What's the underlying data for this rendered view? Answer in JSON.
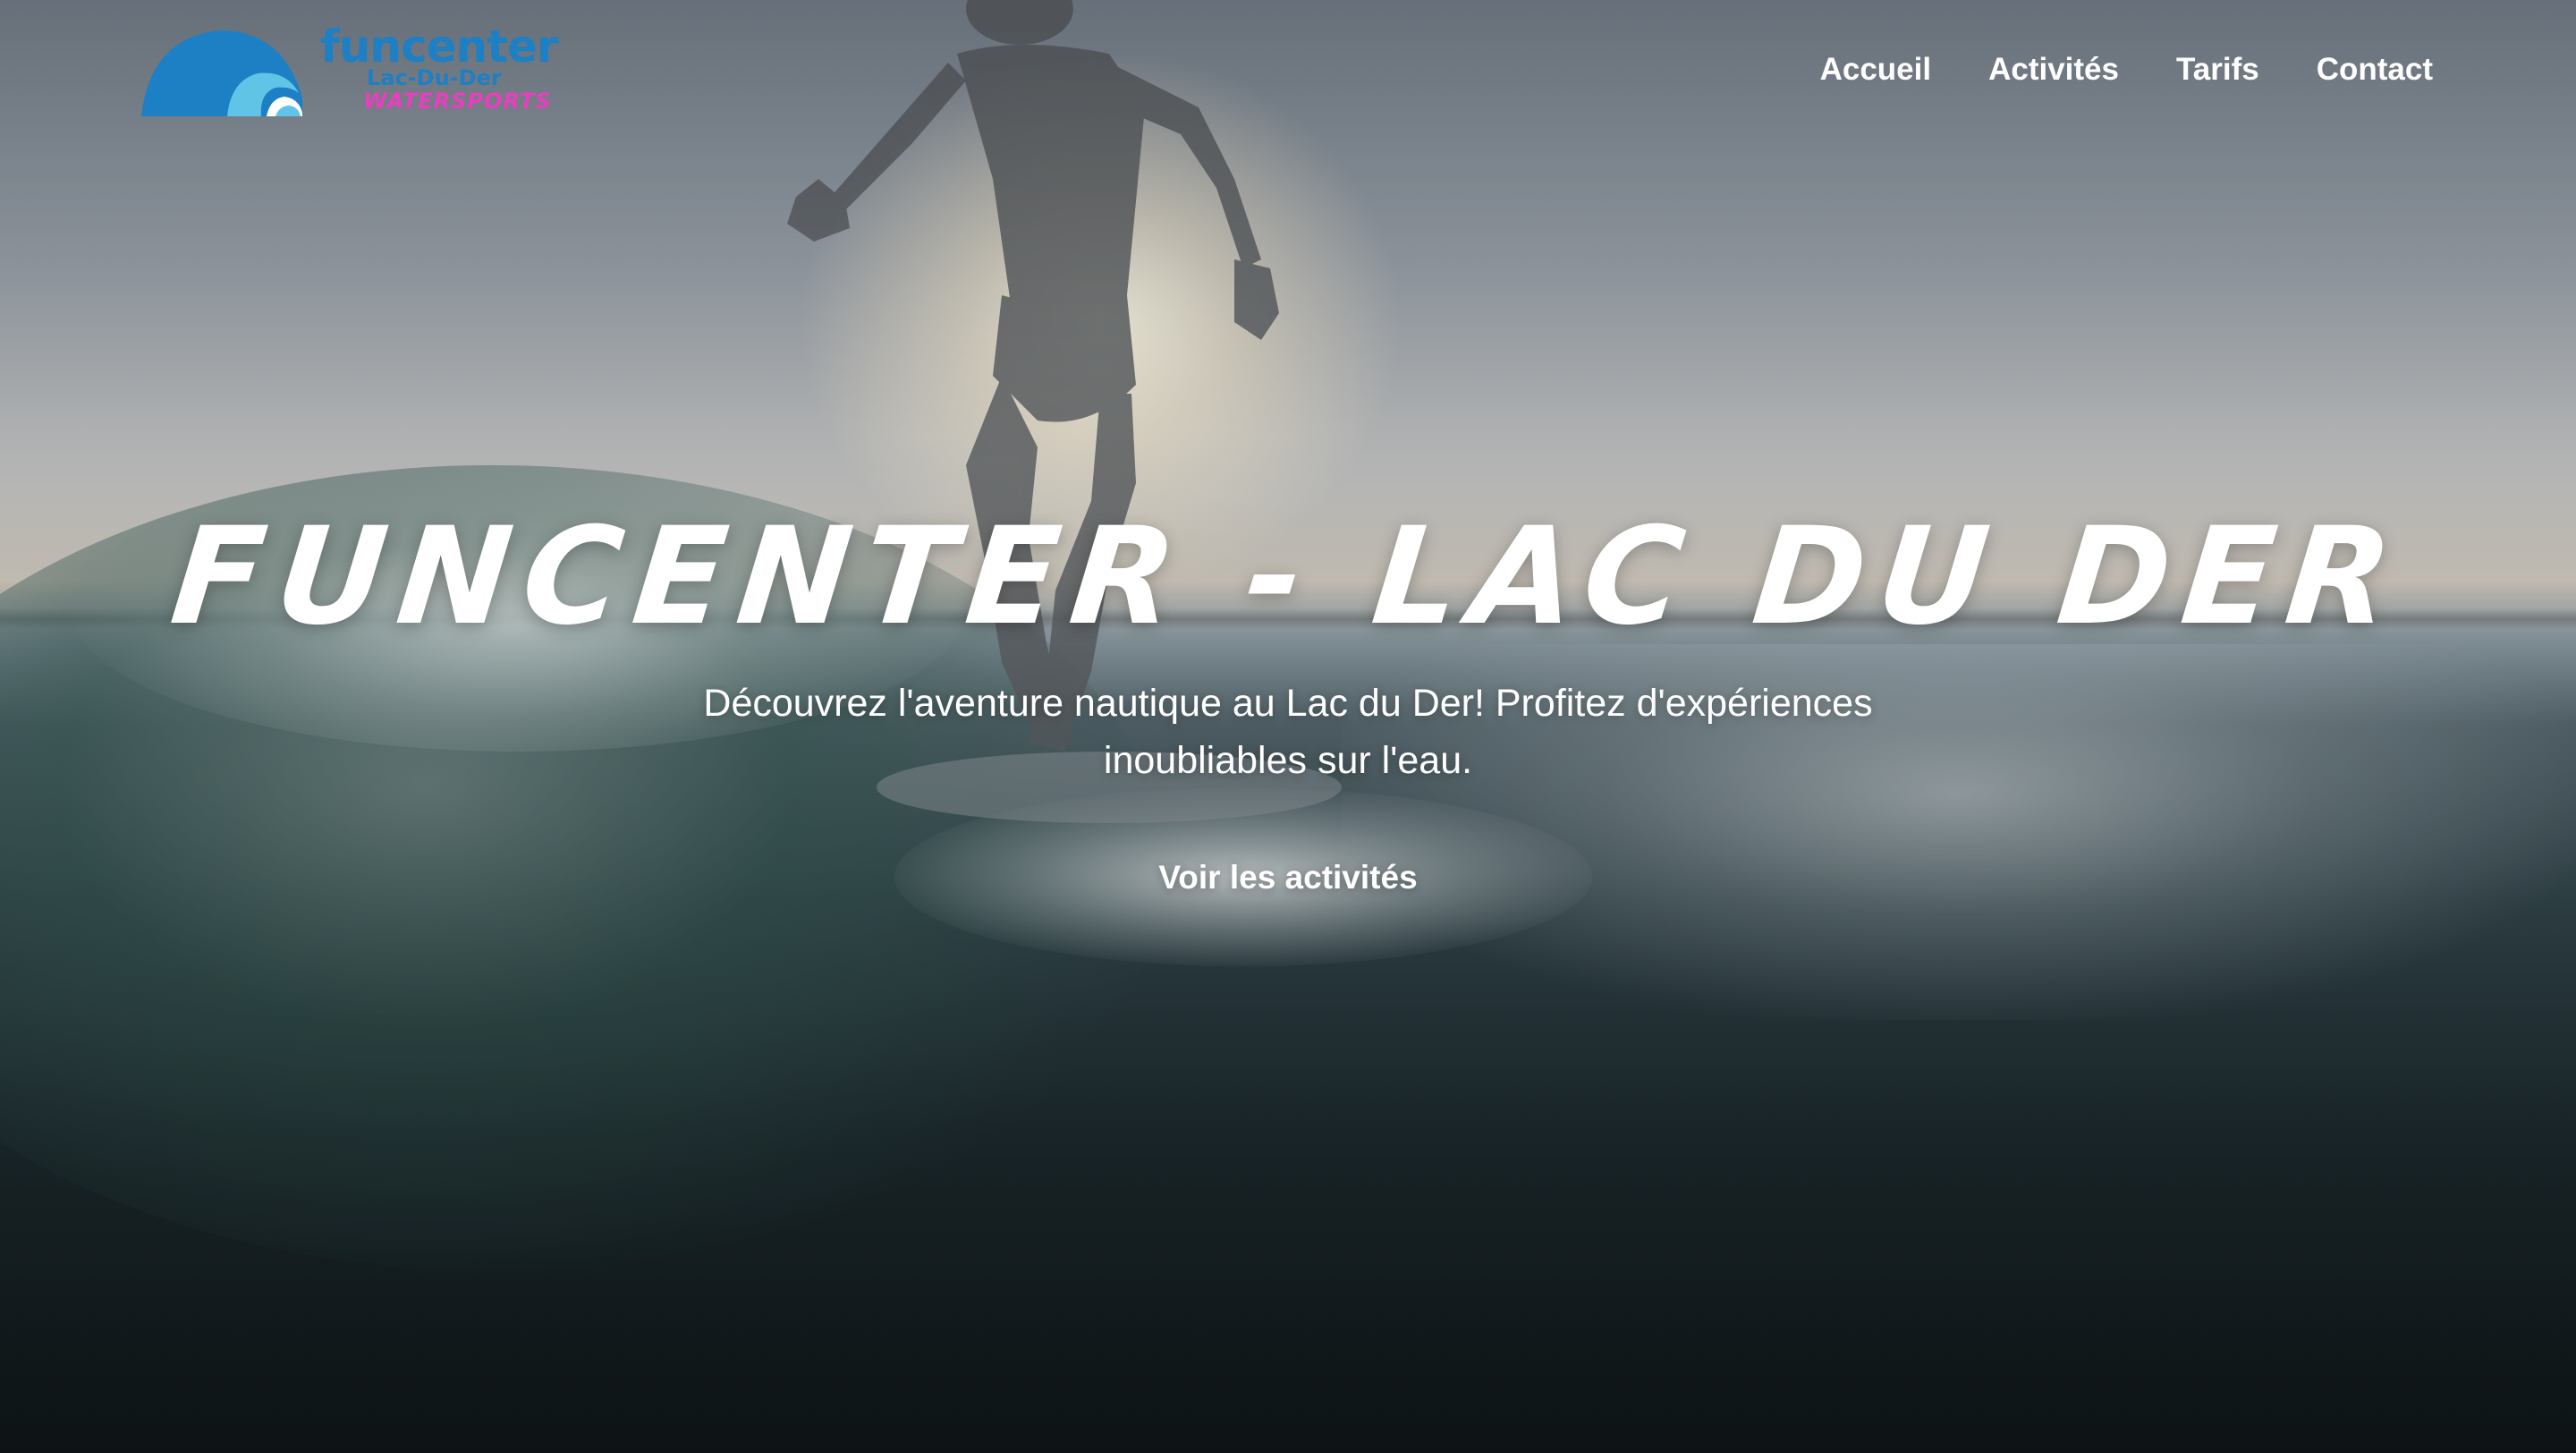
{
  "logo": {
    "brand": "funcenter",
    "sub": "Lac-Du-Der",
    "tagline": "WATERSPORTS"
  },
  "nav": {
    "items": [
      {
        "label": "Accueil"
      },
      {
        "label": "Activités"
      },
      {
        "label": "Tarifs"
      },
      {
        "label": "Contact"
      }
    ]
  },
  "hero": {
    "title": "FUNCENTER - LAC DU DER",
    "description": "Découvrez l'aventure nautique au Lac du Der! Profitez d'expériences inoubliables sur l'eau.",
    "cta_label": "Voir les activités"
  },
  "colors": {
    "brand_blue": "#1d7fc4",
    "brand_light_blue": "#5fc4e6",
    "brand_pink": "#e83fbe",
    "text": "#ffffff"
  }
}
